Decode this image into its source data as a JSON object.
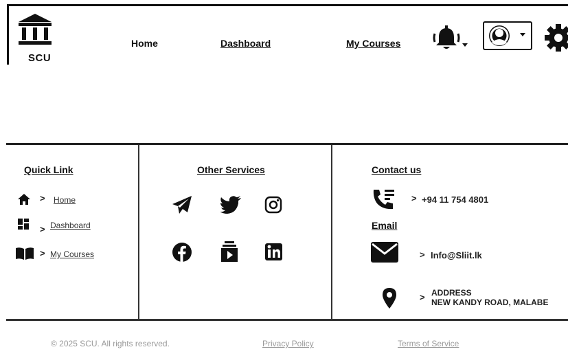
{
  "header": {
    "logo_text": "SCU",
    "nav": [
      {
        "label": "Home"
      },
      {
        "label": "Dashboard"
      },
      {
        "label": "My Courses"
      }
    ],
    "icons": [
      "bell-icon",
      "user-circle-icon",
      "gear-icon"
    ]
  },
  "footer": {
    "quick_link": {
      "title": "Quick Link",
      "items": [
        {
          "icon": "home-icon",
          "label": "Home"
        },
        {
          "icon": "dashboard-icon",
          "label": "Dashboard"
        },
        {
          "icon": "book-icon",
          "label": "My Courses"
        }
      ]
    },
    "other_services": {
      "title": "Other Services",
      "icons": [
        "telegram-icon",
        "twitter-icon",
        "instagram-icon",
        "facebook-icon",
        "youtube-subscriptions-icon",
        "linkedin-icon"
      ]
    },
    "contact": {
      "title": "Contact us",
      "phone": "+94 11 754 4801",
      "email_title": "Email",
      "email": "Info@Sliit.lk",
      "address_label": "ADDRESS",
      "address": "NEW KANDY ROAD, MALABE"
    }
  },
  "bottom_bar": {
    "copyright": "© 2025 SCU. All rights reserved.",
    "privacy": "Privacy Policy",
    "terms": "Terms of Service"
  }
}
